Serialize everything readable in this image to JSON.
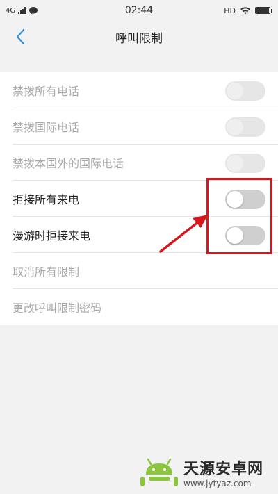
{
  "status_bar": {
    "network": "4G",
    "time": "02:44",
    "hd": "HD"
  },
  "header": {
    "title": "呼叫限制"
  },
  "settings": [
    {
      "label": "禁拨所有电话",
      "enabled": false,
      "toggle_on": false
    },
    {
      "label": "禁拨国际电话",
      "enabled": false,
      "toggle_on": false
    },
    {
      "label": "禁拨本国外的国际电话",
      "enabled": false,
      "toggle_on": false
    },
    {
      "label": "拒接所有来电",
      "enabled": true,
      "toggle_on": false
    },
    {
      "label": "漫游时拒接来电",
      "enabled": true,
      "toggle_on": false
    },
    {
      "label": "取消所有限制",
      "enabled": false
    },
    {
      "label": "更改呼叫限制密码",
      "enabled": false
    }
  ],
  "watermark": {
    "title": "天源安卓网",
    "url": "www.jytyaz.com"
  },
  "colors": {
    "accent": "#2f8fdc",
    "annotation": "#d8161e",
    "disabled_text": "#a8a8a8"
  }
}
